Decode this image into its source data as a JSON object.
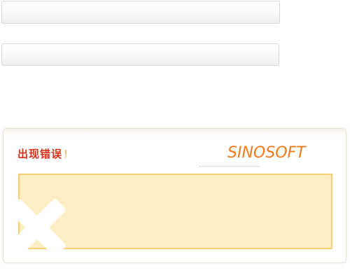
{
  "error_panel": {
    "title": "出现错误",
    "exclaim": "!",
    "logo": "SINOSOFT",
    "message": ""
  },
  "icons": {
    "error": "close-x-icon"
  },
  "colors": {
    "title_red": "#d8301a",
    "logo_orange": "#ef7b1b",
    "message_bg": "#fcedc3",
    "message_border": "#f7cf73"
  }
}
